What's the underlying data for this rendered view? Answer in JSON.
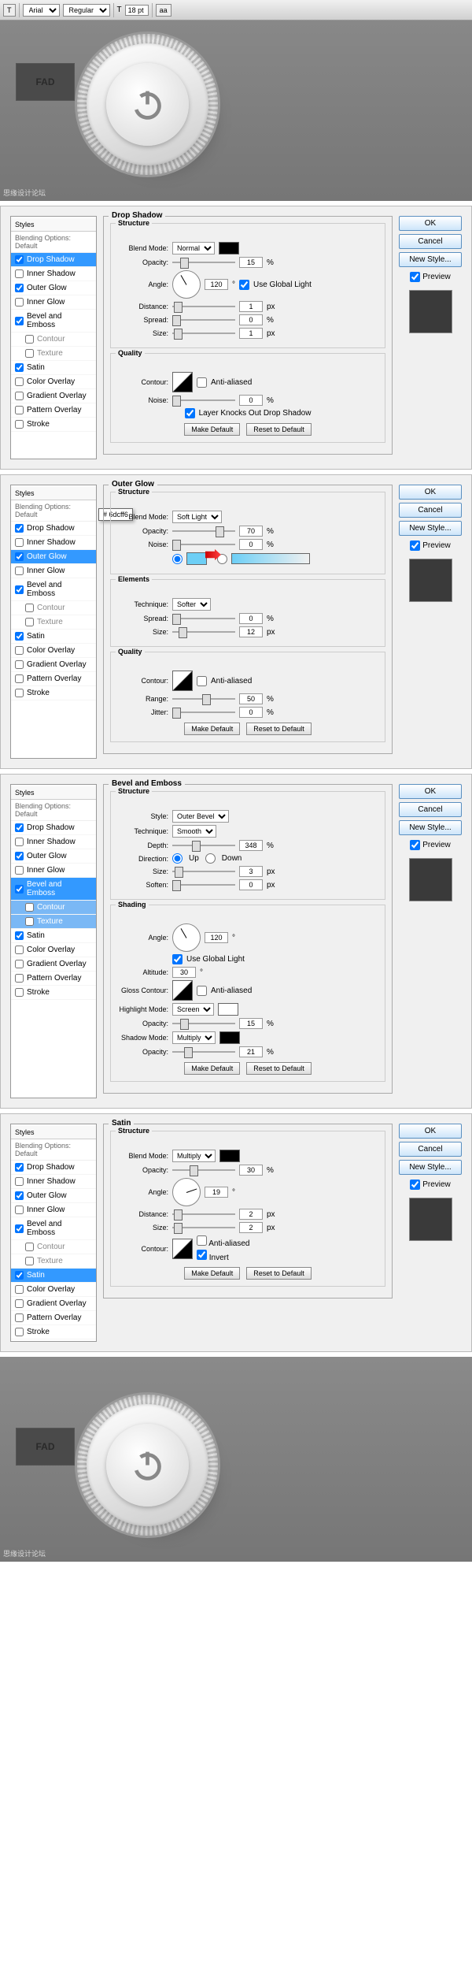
{
  "toolbar": {
    "font": "Arial",
    "weight": "Regular",
    "size_label": "T",
    "size": "18 pt"
  },
  "hero_text": "FAD",
  "watermark": "思缘设计论坛",
  "actions": {
    "ok": "OK",
    "cancel": "Cancel",
    "new_style": "New Style...",
    "preview": "Preview"
  },
  "styles_col": {
    "header": "Styles",
    "sub": "Blending Options: Default",
    "items": [
      "Drop Shadow",
      "Inner Shadow",
      "Outer Glow",
      "Inner Glow",
      "Bevel and Emboss",
      "Contour",
      "Texture",
      "Satin",
      "Color Overlay",
      "Gradient Overlay",
      "Pattern Overlay",
      "Stroke"
    ]
  },
  "common": {
    "structure": "Structure",
    "quality": "Quality",
    "elements": "Elements",
    "shading": "Shading",
    "make_default": "Make Default",
    "reset_default": "Reset to Default",
    "blend_mode": "Blend Mode:",
    "opacity": "Opacity:",
    "angle": "Angle:",
    "use_global": "Use Global Light",
    "distance": "Distance:",
    "spread": "Spread:",
    "size": "Size:",
    "contour": "Contour:",
    "anti_aliased": "Anti-aliased",
    "noise": "Noise:",
    "pct": "%",
    "px": "px",
    "deg": "°"
  },
  "panels": [
    {
      "title": "Drop Shadow",
      "selected": "Drop Shadow",
      "checked": [
        "Drop Shadow",
        "Outer Glow",
        "Bevel and Emboss",
        "Satin"
      ],
      "structure": {
        "blend_mode": "Normal",
        "opacity": "15",
        "angle": "120",
        "use_global": true,
        "distance": "1",
        "spread": "0",
        "size": "1"
      },
      "quality": {
        "noise": "0",
        "knockout_label": "Layer Knocks Out Drop Shadow",
        "knockout": true
      }
    },
    {
      "title": "Outer Glow",
      "selected": "Outer Glow",
      "checked": [
        "Drop Shadow",
        "Outer Glow",
        "Bevel and Emboss",
        "Satin"
      ],
      "color_tooltip": "# 6dcff6",
      "structure": {
        "blend_mode": "Soft Light",
        "opacity": "70",
        "noise": "0"
      },
      "elements": {
        "technique_label": "Technique:",
        "technique": "Softer",
        "spread": "0",
        "size": "12"
      },
      "quality": {
        "range_label": "Range:",
        "range": "50",
        "jitter_label": "Jitter:",
        "jitter": "0"
      }
    },
    {
      "title": "Bevel and Emboss",
      "selected": "Bevel and Emboss",
      "checked": [
        "Drop Shadow",
        "Outer Glow",
        "Bevel and Emboss",
        "Satin"
      ],
      "sub_selected": [
        "Contour",
        "Texture"
      ],
      "structure": {
        "style_label": "Style:",
        "style": "Outer Bevel",
        "technique_label": "Technique:",
        "technique": "Smooth",
        "depth_label": "Depth:",
        "depth": "348",
        "direction_label": "Direction:",
        "up": "Up",
        "down": "Down",
        "size": "3",
        "soften_label": "Soften:",
        "soften": "0"
      },
      "shading": {
        "angle": "120",
        "use_global": true,
        "altitude_label": "Altitude:",
        "altitude": "30",
        "gloss_label": "Gloss Contour:",
        "highlight_mode_label": "Highlight Mode:",
        "highlight_mode": "Screen",
        "highlight_opacity": "15",
        "shadow_mode_label": "Shadow Mode:",
        "shadow_mode": "Multiply",
        "shadow_opacity": "21"
      }
    },
    {
      "title": "Satin",
      "selected": "Satin",
      "checked": [
        "Drop Shadow",
        "Outer Glow",
        "Bevel and Emboss",
        "Satin"
      ],
      "structure": {
        "blend_mode": "Multiply",
        "opacity": "30",
        "angle": "19",
        "distance": "2",
        "size": "2",
        "invert_label": "Invert",
        "invert": true
      }
    }
  ]
}
